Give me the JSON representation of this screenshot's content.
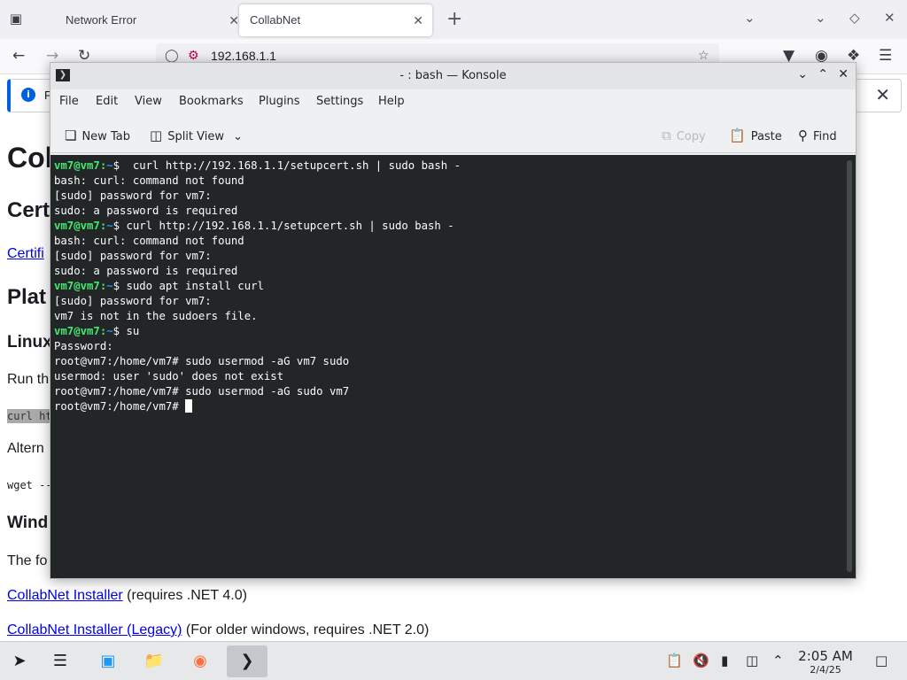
{
  "browser": {
    "tabs": [
      {
        "label": "Network Error"
      },
      {
        "label": "CollabNet"
      }
    ],
    "url": "192.168.1.1",
    "notification_text": "Fi"
  },
  "page": {
    "heading": "Col",
    "section_cert": "Cert",
    "cert_link": "Certifi",
    "section_platform": "Plat",
    "section_linux": "Linux",
    "run_text": "Run th",
    "code_curl": "curl ht",
    "alt_text": "Altern",
    "code_wget": "wget --",
    "section_windows": "Wind",
    "following_text": "The fo",
    "installer_link": "CollabNet Installer",
    "installer_note": " (requires .NET 4.0)",
    "legacy_link": "CollabNet Installer (Legacy)",
    "legacy_note": " (For older windows, requires .NET 2.0)"
  },
  "konsole": {
    "title": "- : bash — Konsole",
    "menu": [
      "File",
      "Edit",
      "View",
      "Bookmarks",
      "Plugins",
      "Settings",
      "Help"
    ],
    "toolbar": {
      "new_tab": "New Tab",
      "split_view": "Split View",
      "copy": "Copy",
      "paste": "Paste",
      "find": "Find"
    },
    "terminal": [
      {
        "user": "vm7@vm7",
        "path": "~",
        "text": "$  curl http://192.168.1.1/setupcert.sh | sudo bash -"
      },
      {
        "text": "bash: curl: command not found"
      },
      {
        "text": "[sudo] password for vm7:"
      },
      {
        "text": "sudo: a password is required"
      },
      {
        "user": "vm7@vm7",
        "path": "~",
        "text": "$ curl http://192.168.1.1/setupcert.sh | sudo bash -"
      },
      {
        "text": "bash: curl: command not found"
      },
      {
        "text": "[sudo] password for vm7:"
      },
      {
        "text": "sudo: a password is required"
      },
      {
        "user": "vm7@vm7",
        "path": "~",
        "text": "$ sudo apt install curl"
      },
      {
        "text": "[sudo] password for vm7:"
      },
      {
        "text": "vm7 is not in the sudoers file."
      },
      {
        "user": "vm7@vm7",
        "path": "~",
        "text": "$ su"
      },
      {
        "text": "Password:"
      },
      {
        "text": "root@vm7:/home/vm7# sudo usermod -aG vm7 sudo"
      },
      {
        "text": "usermod: user 'sudo' does not exist"
      },
      {
        "text": "root@vm7:/home/vm7# sudo usermod -aG sudo vm7"
      },
      {
        "text": "root@vm7:/home/vm7# ",
        "cursor": true
      }
    ]
  },
  "taskbar": {
    "time": "2:05 AM",
    "date": "2/4/25"
  },
  "icons": {
    "tab_list": "tab-list-icon",
    "back": "back-arrow-icon",
    "forward": "forward-arrow-icon",
    "reload": "reload-icon",
    "shield": "shield-icon",
    "bookmark_star": "star-icon",
    "pocket": "pocket-icon",
    "account": "account-icon",
    "extensions": "extensions-icon",
    "menu": "hamburger-menu-icon",
    "app_launcher": "app-launcher-icon",
    "firefox": "firefox-icon",
    "konsole": "konsole-icon"
  },
  "colors": {
    "terminal_bg": "#232627",
    "prompt_user": "#44e870",
    "prompt_path": "#2f8cf0",
    "link": "#0000ee",
    "notif_accent": "#0061e0"
  }
}
